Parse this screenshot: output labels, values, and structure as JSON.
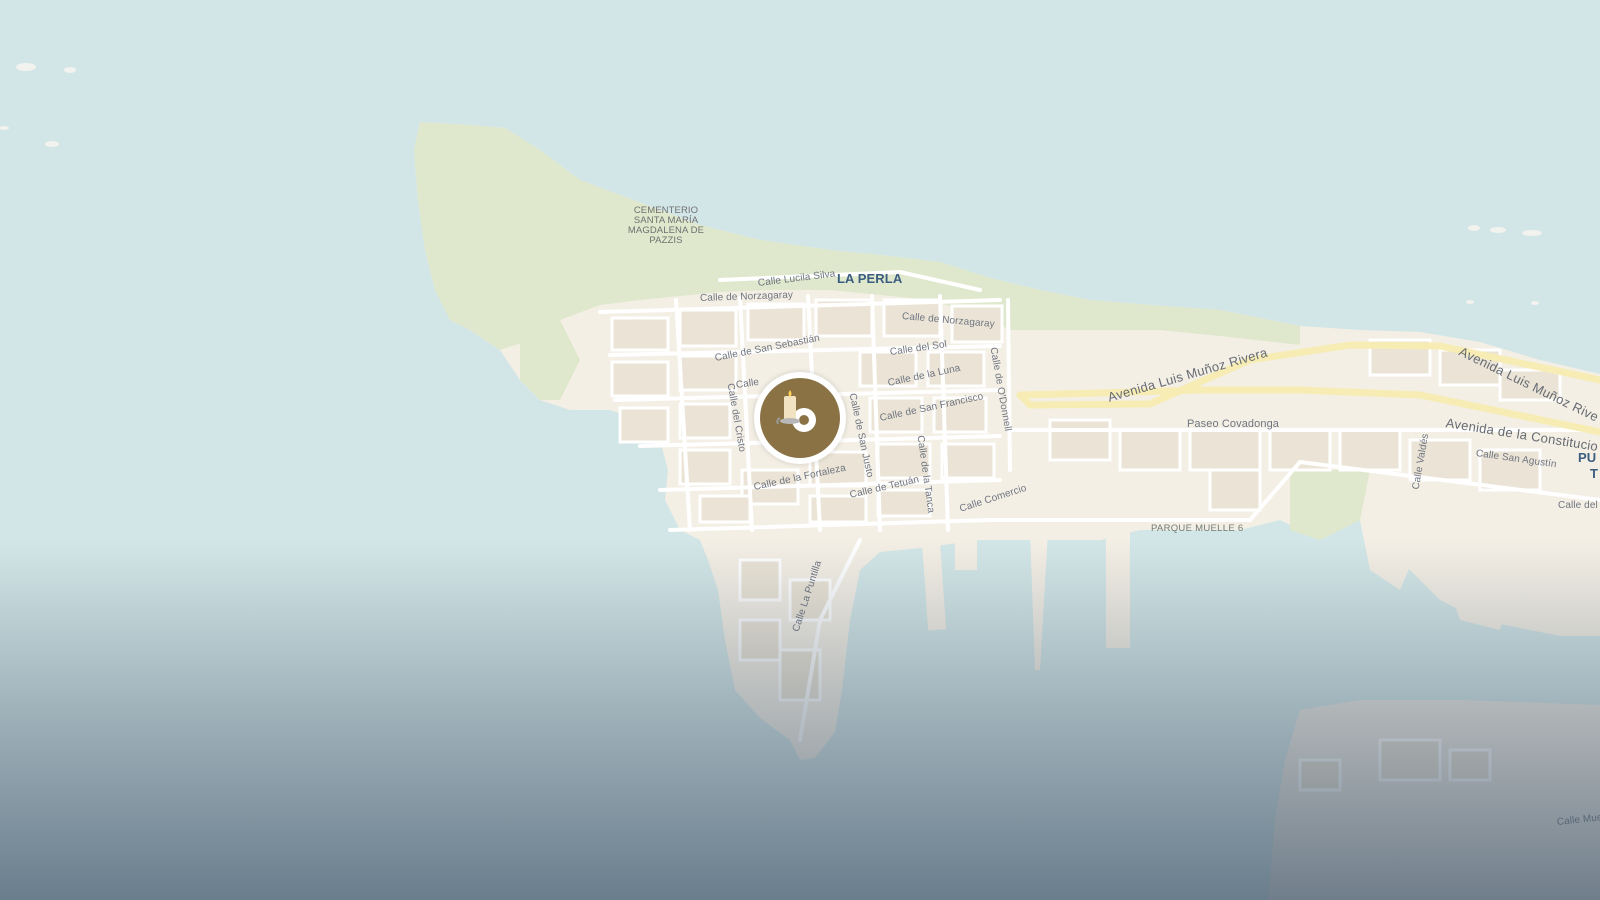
{
  "map": {
    "district_labels": {
      "la_perla": "LA PERLA",
      "pu_partial": "PU",
      "t_partial": "T"
    },
    "poi_labels": {
      "cemetery": "CEMENTERIO SANTA MARÍA MAGDALENA DE PAZZIS",
      "pier": "PARQUE MUELLE 6"
    },
    "street_labels": {
      "lucila_silva": "Calle Lucila Silva",
      "norzagaray_west": "Calle de Norzagaray",
      "norzagaray_east": "Calle de Norzagaray",
      "san_sebastian": "Calle de San Sebastián",
      "del_sol": "Calle del Sol",
      "la_luna": "Calle de la Luna",
      "san_francisco": "Calle de San Francisco",
      "cristo": "Calle del Cristo",
      "san_justo": "Calle de San Justo",
      "la_tanca": "Calle de la Tanca",
      "odonnell": "Calle de O'Donnell",
      "tetuan": "Calle de Tetuán",
      "fortaleza": "Calle de la Fortaleza",
      "comercio": "Calle Comercio",
      "puntilla": "Calle La Puntilla",
      "calle_partial": "Calle",
      "valdes": "Calle Valdés",
      "san_agustin": "Calle San Agustín",
      "calle_del_partial": "Calle del T",
      "calle_mue_partial": "Calle Mue"
    },
    "avenue_labels": {
      "munoz_rivera_1": "Avenida Luis Muñoz Rivera",
      "munoz_rivera_2": "Avenida Luis Muñoz Rive",
      "constitucion": "Avenida de la Constitucio",
      "covadonga": "Paseo Covadonga"
    },
    "marker": {
      "icon": "candle-icon",
      "ring_color": "#ffffff",
      "fill_color": "#8b7245"
    },
    "colors": {
      "water": "#d3e6e7",
      "land": "#f4efe5",
      "park": "#dfe8cc",
      "road": "#ffffff",
      "major_road": "#f6ecb4",
      "building": "#ebe4d6"
    }
  }
}
